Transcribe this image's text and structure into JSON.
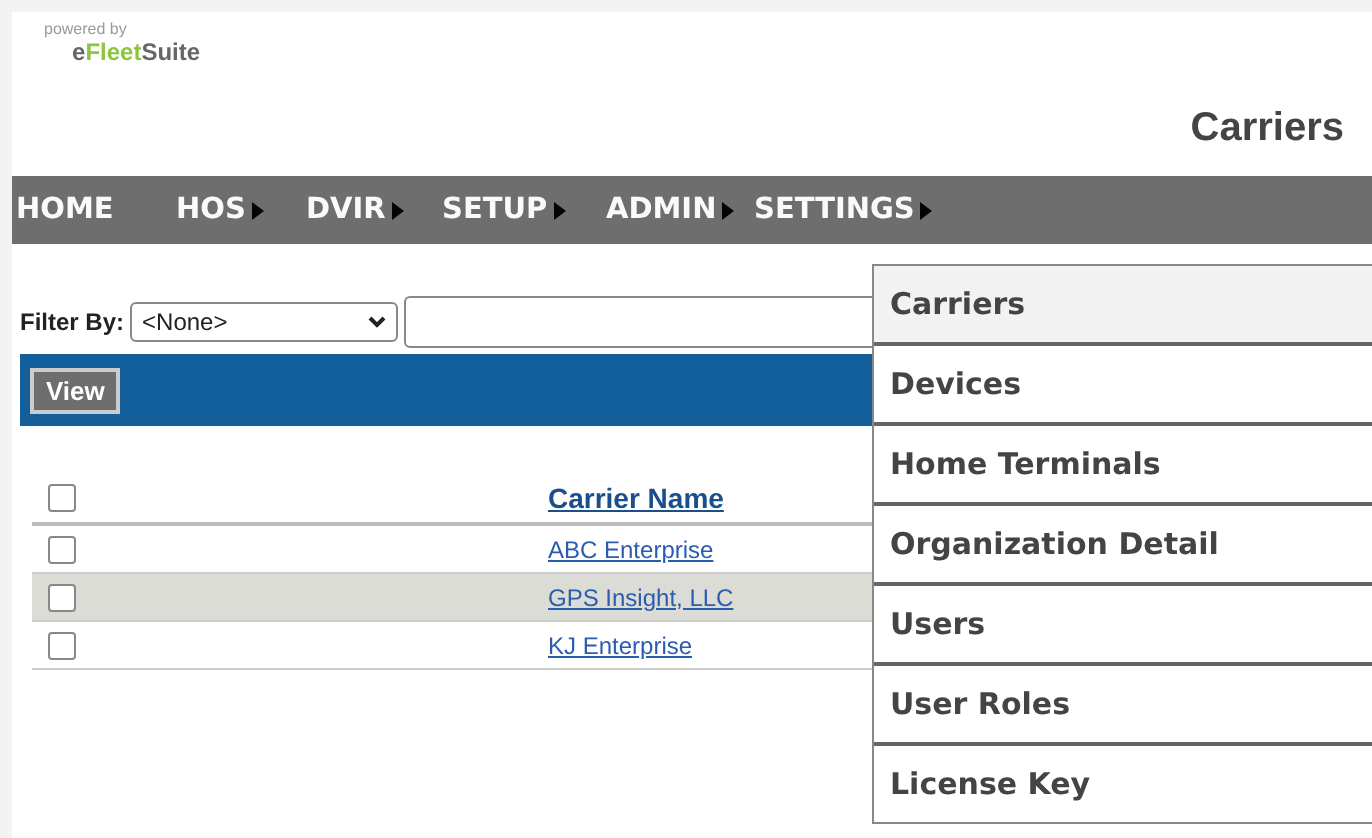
{
  "logo": {
    "tagline": "powered by",
    "brand_part_1": "e",
    "brand_part_2": "Fleet",
    "brand_part_3": "Suite"
  },
  "page_title": "Carriers",
  "nav": [
    {
      "label": "HOME",
      "has_arrow": false
    },
    {
      "label": "HOS",
      "has_arrow": true
    },
    {
      "label": "DVIR",
      "has_arrow": true
    },
    {
      "label": "SETUP",
      "has_arrow": true
    },
    {
      "label": "ADMIN",
      "has_arrow": true
    },
    {
      "label": "SETTINGS",
      "has_arrow": true
    }
  ],
  "filter": {
    "label": "Filter By:",
    "select_value": "<None>"
  },
  "view_button": "View",
  "table": {
    "header": "Carrier Name",
    "header_checked": false,
    "rows": [
      {
        "name": "ABC Enterprise",
        "checked": false,
        "shaded": false
      },
      {
        "name": "GPS Insight, LLC",
        "checked": false,
        "shaded": true
      },
      {
        "name": "KJ Enterprise",
        "checked": false,
        "shaded": false
      }
    ]
  },
  "admin_menu": [
    {
      "label": "Carriers",
      "selected": true
    },
    {
      "label": "Devices",
      "selected": false
    },
    {
      "label": "Home Terminals",
      "selected": false
    },
    {
      "label": "Organization Detail",
      "selected": false
    },
    {
      "label": "Users",
      "selected": false
    },
    {
      "label": "User Roles",
      "selected": false
    },
    {
      "label": "License Key",
      "selected": false
    }
  ]
}
